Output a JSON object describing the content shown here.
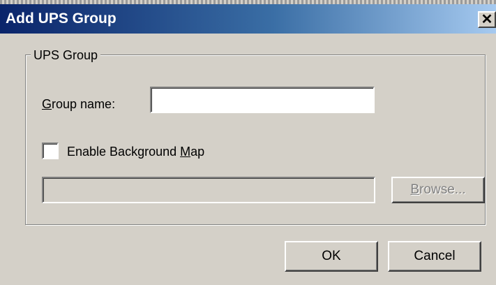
{
  "window": {
    "title": "Add UPS Group",
    "close_glyph": "✕"
  },
  "group": {
    "legend": "UPS Group",
    "group_name_label": "Group name:",
    "group_name_value": "",
    "enable_map_label": "Enable Background Map",
    "enable_map_checked": false,
    "map_path_value": "",
    "browse_label": "Browse..."
  },
  "buttons": {
    "ok": "OK",
    "cancel": "Cancel"
  },
  "icons": {
    "close": "close-icon"
  },
  "colors": {
    "title_bar_start": "#0a246a",
    "title_bar_end": "#a6caf0",
    "dialog_face": "#d4d0c8"
  }
}
